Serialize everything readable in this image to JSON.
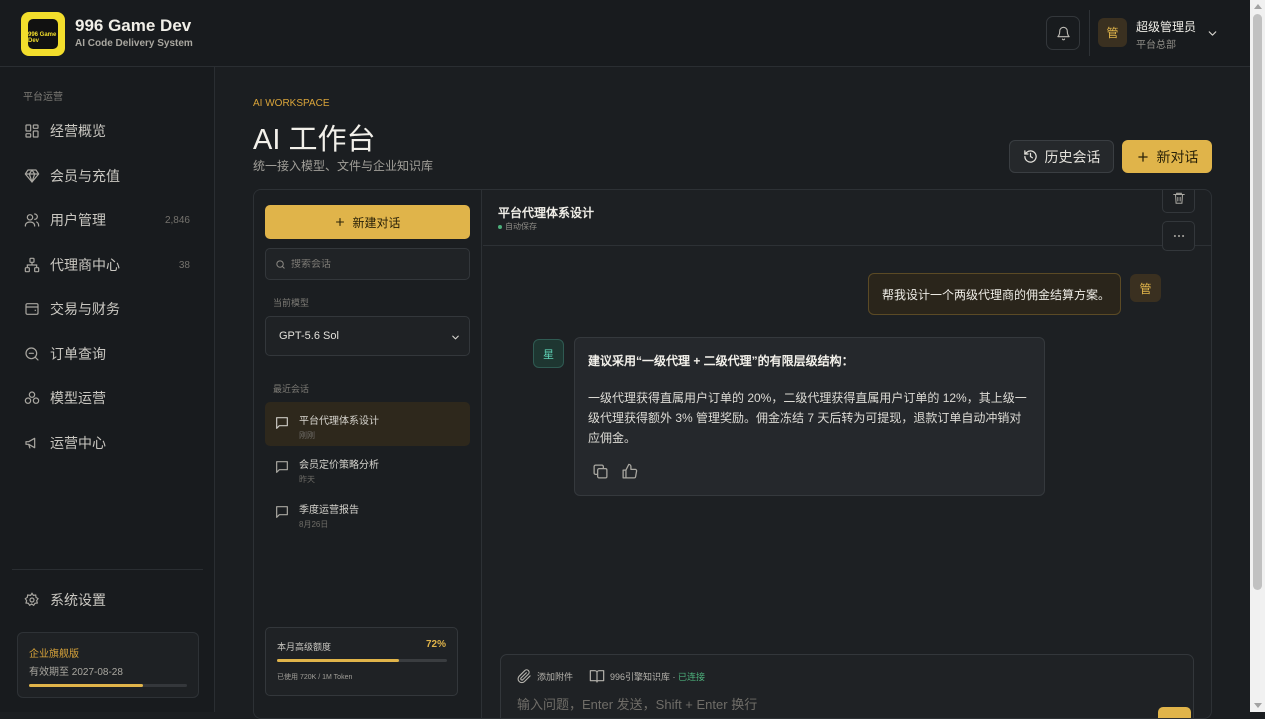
{
  "brand": {
    "title": "996 Game Dev",
    "subtitle": "AI Code Delivery System",
    "logo_text": "996 Game Dev"
  },
  "user": {
    "avatar_char": "管",
    "name": "超级管理员",
    "role": "平台总部"
  },
  "sidebar": {
    "section_label": "平台运营",
    "items": [
      {
        "label": "经营概览",
        "count": "",
        "icon": "grid-icon"
      },
      {
        "label": "会员与充值",
        "count": "",
        "icon": "diamond-icon"
      },
      {
        "label": "用户管理",
        "count": "2,846",
        "icon": "users-icon"
      },
      {
        "label": "代理商中心",
        "count": "38",
        "icon": "hierarchy-icon"
      },
      {
        "label": "交易与财务",
        "count": "",
        "icon": "wallet-icon"
      },
      {
        "label": "订单查询",
        "count": "",
        "icon": "search-doc-icon"
      },
      {
        "label": "模型运营",
        "count": "",
        "icon": "cubes-icon"
      },
      {
        "label": "运营中心",
        "count": "",
        "icon": "megaphone-icon"
      }
    ],
    "settings_label": "系统设置",
    "plan": {
      "title": "企业旗舰版",
      "expiry": "有效期至 2027-08-28",
      "progress": 0.72
    }
  },
  "page": {
    "eyebrow": "AI WORKSPACE",
    "title": "AI 工作台",
    "subtitle": "统一接入模型、文件与企业知识库",
    "history_button": "历史会话",
    "new_button": "新对话"
  },
  "chatlist": {
    "new_chat": "新建对话",
    "search_placeholder": "搜索会话",
    "model_label": "当前模型",
    "model_value": "GPT-5.6 Sol",
    "recent_label": "最近会话",
    "conversations": [
      {
        "title": "平台代理体系设计",
        "date": "刚刚",
        "active": true
      },
      {
        "title": "会员定价策略分析",
        "date": "昨天",
        "active": false
      },
      {
        "title": "季度运营报告",
        "date": "8月26日",
        "active": false
      }
    ],
    "quota": {
      "title": "本月高级额度",
      "percent_label": "72%",
      "percent": 72,
      "usage": "已使用 720K / 1M Token"
    }
  },
  "chat": {
    "title": "平台代理体系设计",
    "status": "自动保存",
    "user_avatar": "管",
    "user_message": "帮我设计一个两级代理商的佣金结算方案。",
    "ai_avatar": "星",
    "ai_heading": "建议采用“一级代理 + 二级代理”的有限层级结构：",
    "ai_body": "一级代理获得直属用户订单的 20%，二级代理获得直属用户订单的 12%，其上级一级代理获得额外 3% 管理奖励。佣金冻结 7 天后转为可提现，退款订单自动冲销对应佣金。",
    "attach_label": "添加附件",
    "kb_label": "996引擎知识库 · ",
    "kb_status": "已连接",
    "input_placeholder": "输入问题，Enter 发送，Shift + Enter 换行"
  },
  "colors": {
    "accent": "#e0b44a",
    "background": "#1b1e21",
    "success": "#4caf7a",
    "logo": "#f3de2c"
  }
}
